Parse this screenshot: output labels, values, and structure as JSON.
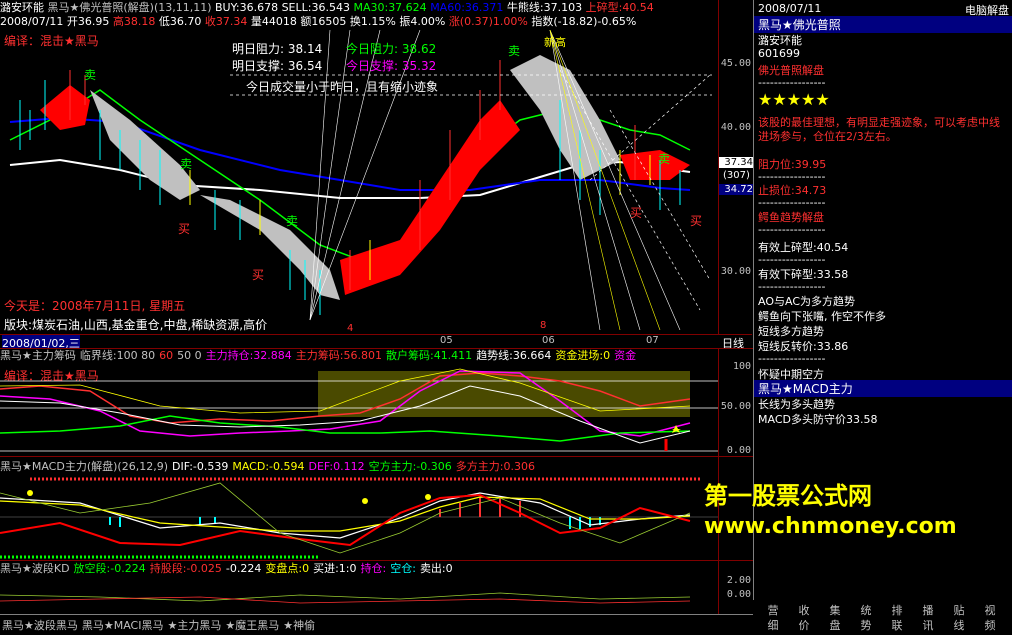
{
  "window": {
    "stock_name": "潞安环能",
    "date_short": "2008/07/11",
    "right_title": "电脑解盘"
  },
  "main_header": {
    "indicator": "黑马★佛光普照(解盘)(13,11,11)",
    "buy": "BUY:36.678",
    "sell": "SELL:36.543",
    "ma30": "MA30:37.624",
    "ma2": "MA60:36.371",
    "bull": "牛熊线:37.103",
    "broken": "上碎型:40.54"
  },
  "quote_line": {
    "date": "2008/07/11",
    "open": "开36.95",
    "high": "高38.18",
    "low": "低36.70",
    "close": "收37.34",
    "volume": "量44018",
    "amount": "额16505",
    "turnover": "换1.15%",
    "amplitude": "振4.00%",
    "change": "涨(0.37)1.00%",
    "index": "指数(-18.82)-0.65%"
  },
  "editor_note": "编译：混击★黑马",
  "resistance_box": {
    "tomorrow_resistance": "明日阻力: 38.14",
    "today_resistance": "今日阻力: 38.62",
    "tomorrow_support": "明日支撑: 36.54",
    "today_support": "今日支撑: 35.32",
    "note": "今日成交量小于昨日，且有缩小迹象"
  },
  "today_text": "今天是：2008年7月11日, 星期五",
  "sector_text": "版块:煤炭石油,山西,基金重仓,中盘,稀缺资源,高价",
  "price_axis": {
    "labels": [
      "45.00",
      "40.00",
      "30.00"
    ],
    "current": "37.34",
    "count": "(307)",
    "low": "34.72"
  },
  "chart_marks": {
    "buy": "买",
    "sell": "卖",
    "new_high": "新高",
    "month_4": "4",
    "month_5": "05",
    "month_6": "06",
    "month_7": "07",
    "month_8": "8"
  },
  "date_bar": {
    "start": "2008/01/02,三",
    "period": "日线"
  },
  "panel2": {
    "header_parts": [
      {
        "text": "黑马★主力筹码",
        "color": "#c0c0c0"
      },
      {
        "text": "临界线:100 80",
        "color": "#c0c0c0"
      },
      {
        "text": "60",
        "color": "#ff3030"
      },
      {
        "text": "50 0",
        "color": "#c0c0c0"
      },
      {
        "text": "主力持仓:32.884",
        "color": "#ff00ff"
      },
      {
        "text": "主力筹码:56.801",
        "color": "#ff3030"
      },
      {
        "text": "散户筹码:41.411",
        "color": "#00ff00"
      },
      {
        "text": "趋势线:36.664",
        "color": "#ffffff"
      },
      {
        "text": "资金进场:0",
        "color": "#ffff00"
      },
      {
        "text": "资金",
        "color": "#ff00ff"
      }
    ],
    "editor": "编译：混击★黑马",
    "axis": [
      "100",
      "50.00",
      "0.00"
    ]
  },
  "panel3": {
    "header_parts": [
      {
        "text": "黑马★MACD主力(解盘)(26,12,9)",
        "color": "#c0c0c0"
      },
      {
        "text": "DIF:-0.539",
        "color": "#ffffff"
      },
      {
        "text": "MACD:-0.594",
        "color": "#ffff00"
      },
      {
        "text": "DEF:0.112",
        "color": "#ff00ff"
      },
      {
        "text": "空方主力:-0.306",
        "color": "#00ff00"
      },
      {
        "text": "多方主力:0.306",
        "color": "#ff3030"
      }
    ]
  },
  "panel4": {
    "header_parts": [
      {
        "text": "黑马★波段KD",
        "color": "#c0c0c0"
      },
      {
        "text": "放空段:-0.224",
        "color": "#00ff00"
      },
      {
        "text": "持股段:-0.025",
        "color": "#ff3030"
      },
      {
        "text": "-0.224",
        "color": "#ffffff"
      },
      {
        "text": "变盘点:0",
        "color": "#ffff00"
      },
      {
        "text": "买进:1:0",
        "color": "#ffffff"
      },
      {
        "text": "持仓:",
        "color": "#ff00ff"
      },
      {
        "text": "空仓:",
        "color": "#00ffff"
      },
      {
        "text": "卖出:0",
        "color": "#ffffff"
      }
    ],
    "axis": [
      "2.00",
      "0.00"
    ]
  },
  "bottom_tabs": [
    "黑马★波段黑马",
    "黑马★MACI黑马",
    "★主力黑马",
    "★魔王黑马",
    "★神偷"
  ],
  "right_panel": {
    "date": "2008/07/11",
    "title": "黑马★佛光普照",
    "name": "潞安环能",
    "code": "601699",
    "subtitle": "佛光普照解盘",
    "separator": "-----------------",
    "stars": "★★★★★",
    "advice": "该股的最佳理想，有明显走强迹象，可以考虑中线进场参与，仓位在2/3左右。",
    "resistance": "阻力位:39.95",
    "support": "止损位:34.73",
    "trend_title": "鳄鱼趋势解盘",
    "up_fractal": "有效上碎型:40.54",
    "down_fractal": "有效下碎型:33.58",
    "lines": [
      "AO与AC为多方趋势",
      "鳄鱼向下张嘴, 作空不作多",
      "短线多方趋势",
      "短线反转价:33.86"
    ],
    "middle_line": "怀疑中期空方",
    "macd_title": "黑马★MACD主力",
    "macd_line1": "长线为多头趋势",
    "macd_line2": "MACD多头防守价33.58"
  },
  "side_tabs": [
    "营",
    "收",
    "集",
    "统",
    "排",
    "播",
    "贴",
    "视",
    "细",
    "价",
    "盘",
    "势",
    "联",
    "讯",
    "线",
    "频"
  ],
  "watermark": {
    "line1": "第一股票公式网",
    "line2": "www.chnmoney.com"
  },
  "colors": {
    "up": "#ff3030",
    "down": "#00ffff",
    "ma_white": "#ffffff",
    "ma_blue": "#0000ff",
    "ma_green": "#00ff00",
    "yellow": "#ffff00",
    "magenta": "#ff00ff"
  }
}
